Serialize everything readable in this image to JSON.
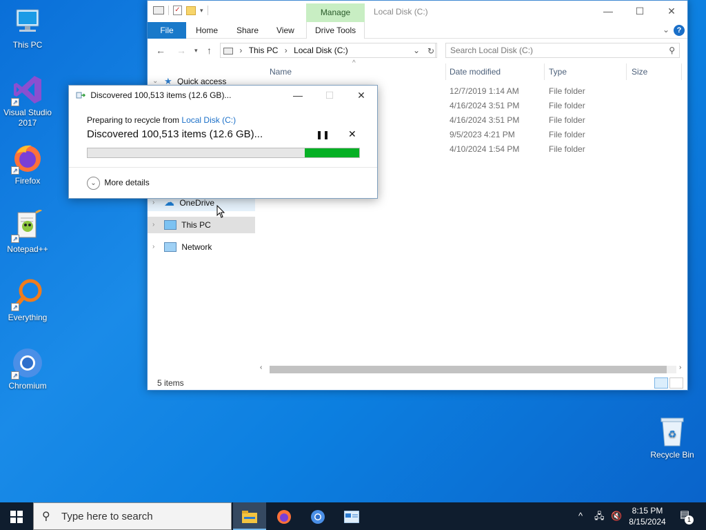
{
  "desktop": {
    "icons": [
      {
        "label": "This PC"
      },
      {
        "label": "Visual Studio 2017"
      },
      {
        "label": "Firefox"
      },
      {
        "label": "Notepad++"
      },
      {
        "label": "Everything"
      },
      {
        "label": "Chromium"
      },
      {
        "label": "Recycle Bin"
      }
    ]
  },
  "explorer": {
    "title": "Local Disk (C:)",
    "context_tab": "Manage",
    "ribbon_tabs": [
      "File",
      "Home",
      "Share",
      "View",
      "Drive Tools"
    ],
    "help_label": "?",
    "address": {
      "crumbs": [
        "This PC",
        "Local Disk (C:)"
      ]
    },
    "search_placeholder": "Search Local Disk (C:)",
    "nav": {
      "quick_access": "Quick access",
      "onedrive": "OneDrive",
      "this_pc": "This PC",
      "network": "Network"
    },
    "columns": {
      "name": "Name",
      "date": "Date modified",
      "type": "Type",
      "size": "Size"
    },
    "rows": [
      {
        "date": "12/7/2019 1:14 AM",
        "type": "File folder"
      },
      {
        "date": "4/16/2024 3:51 PM",
        "type": "File folder"
      },
      {
        "date": "4/16/2024 3:51 PM",
        "type": "File folder"
      },
      {
        "date": "9/5/2023 4:21 PM",
        "type": "File folder"
      },
      {
        "date": "4/10/2024 1:54 PM",
        "type": "File folder"
      }
    ],
    "status": "5 items"
  },
  "dialog": {
    "title": "Discovered 100,513 items (12.6 GB)...",
    "sub_prefix": "Preparing to recycle from ",
    "sub_link": "Local Disk (C:)",
    "main_text": "Discovered 100,513 items (12.6 GB)...",
    "progress_fraction": 0.8,
    "progress_fill_fraction": 0.2,
    "more_details": "More details"
  },
  "taskbar": {
    "search_placeholder": "Type here to search",
    "time": "8:15 PM",
    "date": "8/15/2024",
    "notification_count": "1"
  },
  "colors": {
    "accent": "#1979ca",
    "progress": "#06b025",
    "manage_tab": "#c8eec3",
    "desktop": "#0a6fd8",
    "taskbar": "#0f1d2e"
  }
}
